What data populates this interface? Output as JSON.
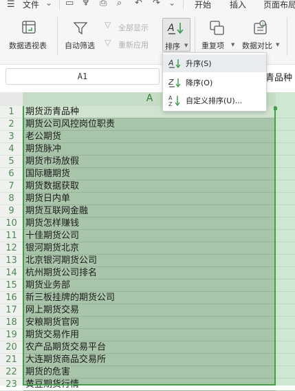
{
  "menubar": {
    "items": [
      "文件",
      "开始",
      "插入",
      "页面布局"
    ]
  },
  "ribbon": {
    "pivot_label": "数据透视表",
    "autofilter_label": "自动筛选",
    "showall_label": "全部显示",
    "reapply_label": "重新应用",
    "sort_label": "排序",
    "duplicates_label": "重复项",
    "compare_label": "数据对比"
  },
  "sort_menu": {
    "items": [
      {
        "label": "升序(S)",
        "icon": "sort-ascending-icon"
      },
      {
        "label": "降序(O)",
        "icon": "sort-descending-icon"
      },
      {
        "label": "自定义排序(U)...",
        "icon": "custom-sort-icon"
      }
    ]
  },
  "formula_bar": {
    "name_box": "A1",
    "content_fragment": "青品种"
  },
  "sheet": {
    "column_header": "A",
    "rows": [
      {
        "n": "1",
        "v": "期货沥青品种"
      },
      {
        "n": "2",
        "v": "期货公司风控岗位职责"
      },
      {
        "n": "3",
        "v": "老公期货"
      },
      {
        "n": "4",
        "v": "期货脉冲"
      },
      {
        "n": "5",
        "v": "期货市场放假"
      },
      {
        "n": "6",
        "v": "国际糖期货"
      },
      {
        "n": "7",
        "v": "期货数据获取"
      },
      {
        "n": "8",
        "v": "期货日内单"
      },
      {
        "n": "9",
        "v": "期货互联网金融"
      },
      {
        "n": "10",
        "v": "期货怎样赚钱"
      },
      {
        "n": "11",
        "v": "十佳期货公司"
      },
      {
        "n": "12",
        "v": "银河期货北京"
      },
      {
        "n": "13",
        "v": "北京银河期货公司"
      },
      {
        "n": "14",
        "v": "杭州期货公司排名"
      },
      {
        "n": "15",
        "v": "期货业务部"
      },
      {
        "n": "16",
        "v": "新三板挂牌的期货公司"
      },
      {
        "n": "17",
        "v": "网上期货交易"
      },
      {
        "n": "18",
        "v": "安粮期货官网"
      },
      {
        "n": "19",
        "v": "期货交易作用"
      },
      {
        "n": "20",
        "v": "农产品期货交易平台"
      },
      {
        "n": "21",
        "v": "大连期货商品交易所"
      },
      {
        "n": "22",
        "v": "期货的危害"
      },
      {
        "n": "23",
        "v": "黄豆期货行情"
      }
    ]
  },
  "colors": {
    "selection": "#a9c5a9",
    "selection_border": "#3fa146",
    "row_number": "#4a8a4e"
  }
}
